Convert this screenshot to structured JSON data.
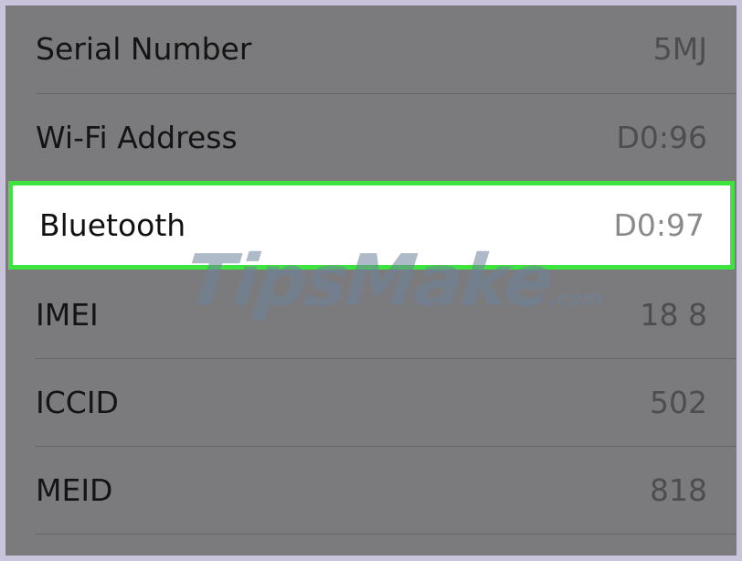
{
  "rows": [
    {
      "label": "Serial Number",
      "value": "5MJ"
    },
    {
      "label": "Wi-Fi Address",
      "value": "D0:96"
    },
    {
      "label": "Bluetooth",
      "value": "D0:97"
    },
    {
      "label": "IMEI",
      "value": "18 8"
    },
    {
      "label": "ICCID",
      "value": "502"
    },
    {
      "label": "MEID",
      "value": "818"
    }
  ],
  "highlight_color": "#3ee43e",
  "watermark": {
    "main": "TipsMake",
    "suffix": ".com"
  }
}
